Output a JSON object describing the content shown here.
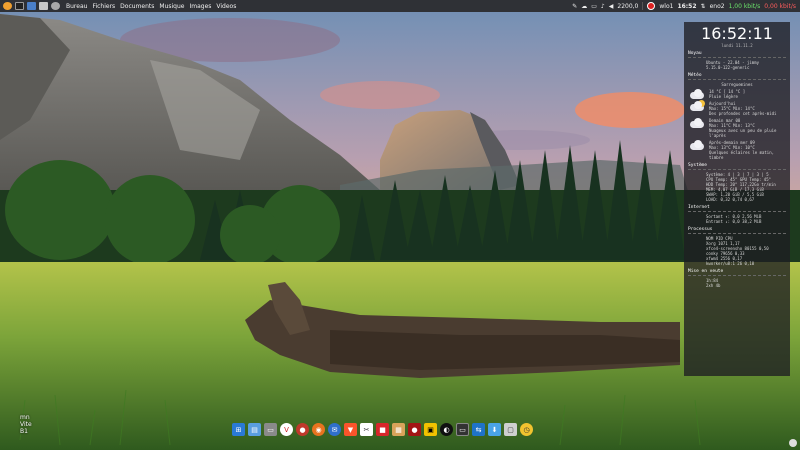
{
  "top_panel": {
    "menu": [
      "Bureau",
      "Fichiers",
      "Documents",
      "Musique",
      "Images",
      "Videos"
    ],
    "tray": {
      "cpu_freq": "2200,0",
      "user": "wlo1",
      "clock": "16:52",
      "iface": "eno2",
      "net_up": "1,00 kbit/s",
      "net_down": "0,00 kbit/s"
    }
  },
  "conky": {
    "clock": "16:52:11",
    "date": "lundi 11.11.2",
    "sections": {
      "system_info": "Noyau",
      "weather": "Météo",
      "system": "Système",
      "internet": "Internet",
      "processes": "Processus",
      "updates": "Mise en veute"
    },
    "system_info_lines": [
      "Ubuntu - 22.04 - jimmy",
      "5.15.0-122-generic"
    ],
    "weather": {
      "location": "Sarreguemines",
      "current": [
        "14 °C [ 14 °C ]",
        "Pluie légère"
      ],
      "forecasts": [
        {
          "title": "Aujourd'hui",
          "lines": [
            "Max: 15°C   Min: 14°C",
            "Des profondes cet après-midi"
          ]
        },
        {
          "title": "Demain mar 08",
          "lines": [
            "Max: 11°C   Min: 13°C",
            "Nuageux avec un peu de pluie l'après"
          ]
        },
        {
          "title": "Après-demain mer 09",
          "lines": [
            "Max: 13°C   Min: 10°C",
            "Quelques éclaires le matin, timbre"
          ]
        }
      ]
    },
    "system_lines": [
      "Système:   4 | 3 | 7 | 3 | 5",
      "CPU Temp:   45°   GPU Temp: 45°",
      "HDD Temp:   20°   117,22Go tr/min",
      "MEM:        4,07 GiB / 17,3 GiB",
      "SWAP:       1,20 GiB / 5,5 GiB",
      "LOAD:       0,32 0,74 0,67"
    ],
    "internet_lines": [
      "Sortant ↑:    0,0    2,56 MiB",
      "Entrant ↓:    0,0    38,2 MiB"
    ],
    "process_lines": [
      "NOM              PID    CPU",
      "Xorg             1071   1,17",
      "xfce4-screensho  80155  0,50",
      "conky            79656  0,33",
      "xfwm4            2556   0,17",
      "kworker/u8:1     26   0,10"
    ],
    "update_lines": [
      "1h:84",
      "2xh 4b"
    ]
  },
  "desktop_text": [
    "mn",
    "Vite",
    "B1"
  ],
  "colors": {
    "panel_bg": "#2f3136",
    "conky_bg": "#1e1e22",
    "net_up": "#6be36b",
    "net_down": "#ff5c5c"
  },
  "dock_icons": [
    "windows-icon",
    "files-icon",
    "folder-icon",
    "vivaldi-icon",
    "app-red-icon",
    "firefox-icon",
    "thunderbird-icon",
    "brave-icon",
    "screenshot-icon",
    "app-red2-icon",
    "image-viewer-icon",
    "app-red3-icon",
    "app-yellow-icon",
    "app-dark-icon",
    "terminal-icon",
    "network-icon",
    "download-icon",
    "app-gray-icon",
    "clock-icon"
  ]
}
